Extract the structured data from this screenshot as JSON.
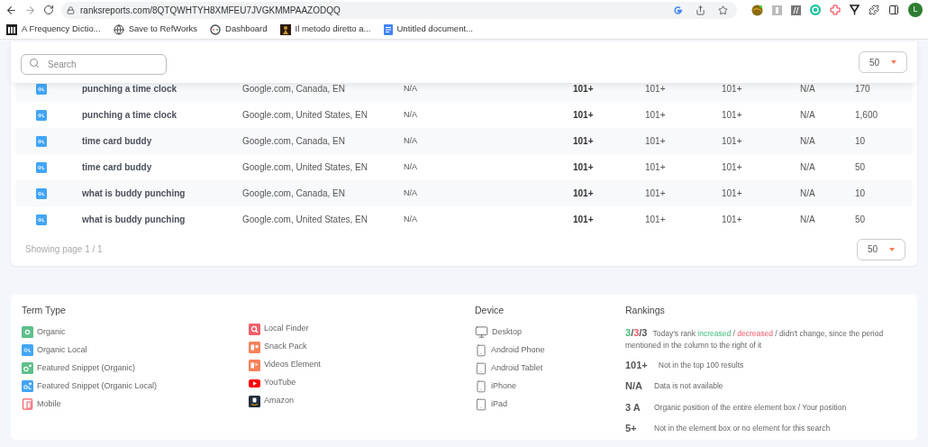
{
  "browser": {
    "url": "ranksreports.com/8QTQWHTYH8XMFEU7JVGKMMPAAZODQQ",
    "profile_initial": "L",
    "bookmarks": [
      {
        "label": "A Frequency Dictio...",
        "kind": "columns"
      },
      {
        "label": "Save to RefWorks",
        "kind": "globe"
      },
      {
        "label": "Dashboard",
        "kind": "dial"
      },
      {
        "label": "Il metodo diretto a...",
        "kind": "figure"
      },
      {
        "label": "Untitled document...",
        "kind": "doc"
      }
    ]
  },
  "toolbar": {
    "search": {
      "placeholder": "Search"
    },
    "page_size": "50"
  },
  "table": {
    "rows": [
      {
        "keyword": "punching a time clock",
        "location": "Google.com, Canada, EN",
        "column_3": "N/A",
        "column_4": "101+",
        "column_5": "101+",
        "column_6": "101+",
        "column_7": "N/A",
        "column_8": "170"
      },
      {
        "keyword": "punching a time clock",
        "location": "Google.com, United States, EN",
        "column_3": "N/A",
        "column_4": "101+",
        "column_5": "101+",
        "column_6": "101+",
        "column_7": "N/A",
        "column_8": "1,600"
      },
      {
        "keyword": "time card buddy",
        "location": "Google.com, Canada, EN",
        "column_3": "N/A",
        "column_4": "101+",
        "column_5": "101+",
        "column_6": "101+",
        "column_7": "N/A",
        "column_8": "10"
      },
      {
        "keyword": "time card buddy",
        "location": "Google.com, United States, EN",
        "column_3": "N/A",
        "column_4": "101+",
        "column_5": "101+",
        "column_6": "101+",
        "column_7": "N/A",
        "column_8": "50"
      },
      {
        "keyword": "what is buddy punching",
        "location": "Google.com, Canada, EN",
        "column_3": "N/A",
        "column_4": "101+",
        "column_5": "101+",
        "column_6": "101+",
        "column_7": "N/A",
        "column_8": "10"
      },
      {
        "keyword": "what is buddy punching",
        "location": "Google.com, United States, EN",
        "column_3": "N/A",
        "column_4": "101+",
        "column_5": "101+",
        "column_6": "101+",
        "column_7": "N/A",
        "column_8": "50"
      }
    ],
    "footer": "Showing page 1 / 1",
    "page_size": "50"
  },
  "legend": {
    "term_type": {
      "title": "Term Type",
      "columns": [
        [
          {
            "label": "Organic",
            "kind": "organic"
          },
          {
            "label": "Organic Local",
            "kind": "organic_local"
          },
          {
            "label": "Featured Snippet (Organic)",
            "kind": "featured_organic"
          },
          {
            "label": "Featured Snippet (Organic Local)",
            "kind": "featured_local"
          },
          {
            "label": "Mobile",
            "kind": "mobile"
          }
        ],
        [
          {
            "label": "Local Finder",
            "kind": "local_finder"
          },
          {
            "label": "Snack Pack",
            "kind": "snack_pack"
          },
          {
            "label": "Videos Element",
            "kind": "videos"
          },
          {
            "label": "YouTube",
            "kind": "youtube"
          },
          {
            "label": "Amazon",
            "kind": "amazon"
          }
        ]
      ]
    },
    "device": {
      "title": "Device",
      "items": [
        {
          "label": "Desktop",
          "kind": "desktop"
        },
        {
          "label": "Android Phone",
          "kind": "phone"
        },
        {
          "label": "Android Tablet",
          "kind": "tablet"
        },
        {
          "label": "iPhone",
          "kind": "phone"
        },
        {
          "label": "iPad",
          "kind": "tablet"
        }
      ]
    },
    "rankings": {
      "title": "Rankings",
      "items": [
        {
          "symbol": [
            {
              "text": "3",
              "kind": "up"
            },
            {
              "text": "/",
              "kind": "plain"
            },
            {
              "text": "3",
              "kind": "down"
            },
            {
              "text": "/3",
              "kind": "plain"
            }
          ],
          "description": [
            {
              "text": "Today's rank ",
              "kind": "plain"
            },
            {
              "text": "increased",
              "kind": "up"
            },
            {
              "text": " / ",
              "kind": "plain"
            },
            {
              "text": "decreased",
              "kind": "down"
            },
            {
              "text": " / didn't change, since the period mentioned in the column to the right of it",
              "kind": "plain"
            }
          ]
        },
        {
          "symbol": [
            {
              "text": "101+",
              "kind": "plain"
            }
          ],
          "description": [
            {
              "text": "Not in the top 100 results",
              "kind": "plain"
            }
          ]
        },
        {
          "symbol": [
            {
              "text": "N/A",
              "kind": "plain"
            }
          ],
          "description": [
            {
              "text": "Data is not available",
              "kind": "plain"
            }
          ]
        },
        {
          "symbol": [
            {
              "text": "3 A",
              "kind": "plain"
            }
          ],
          "description": [
            {
              "text": "Organic position of the entire element box / Your position",
              "kind": "plain"
            }
          ]
        },
        {
          "symbol": [
            {
              "text": "5+",
              "kind": "plain"
            }
          ],
          "description": [
            {
              "text": "Not in the element box or no element for this search",
              "kind": "plain"
            }
          ]
        }
      ]
    }
  }
}
